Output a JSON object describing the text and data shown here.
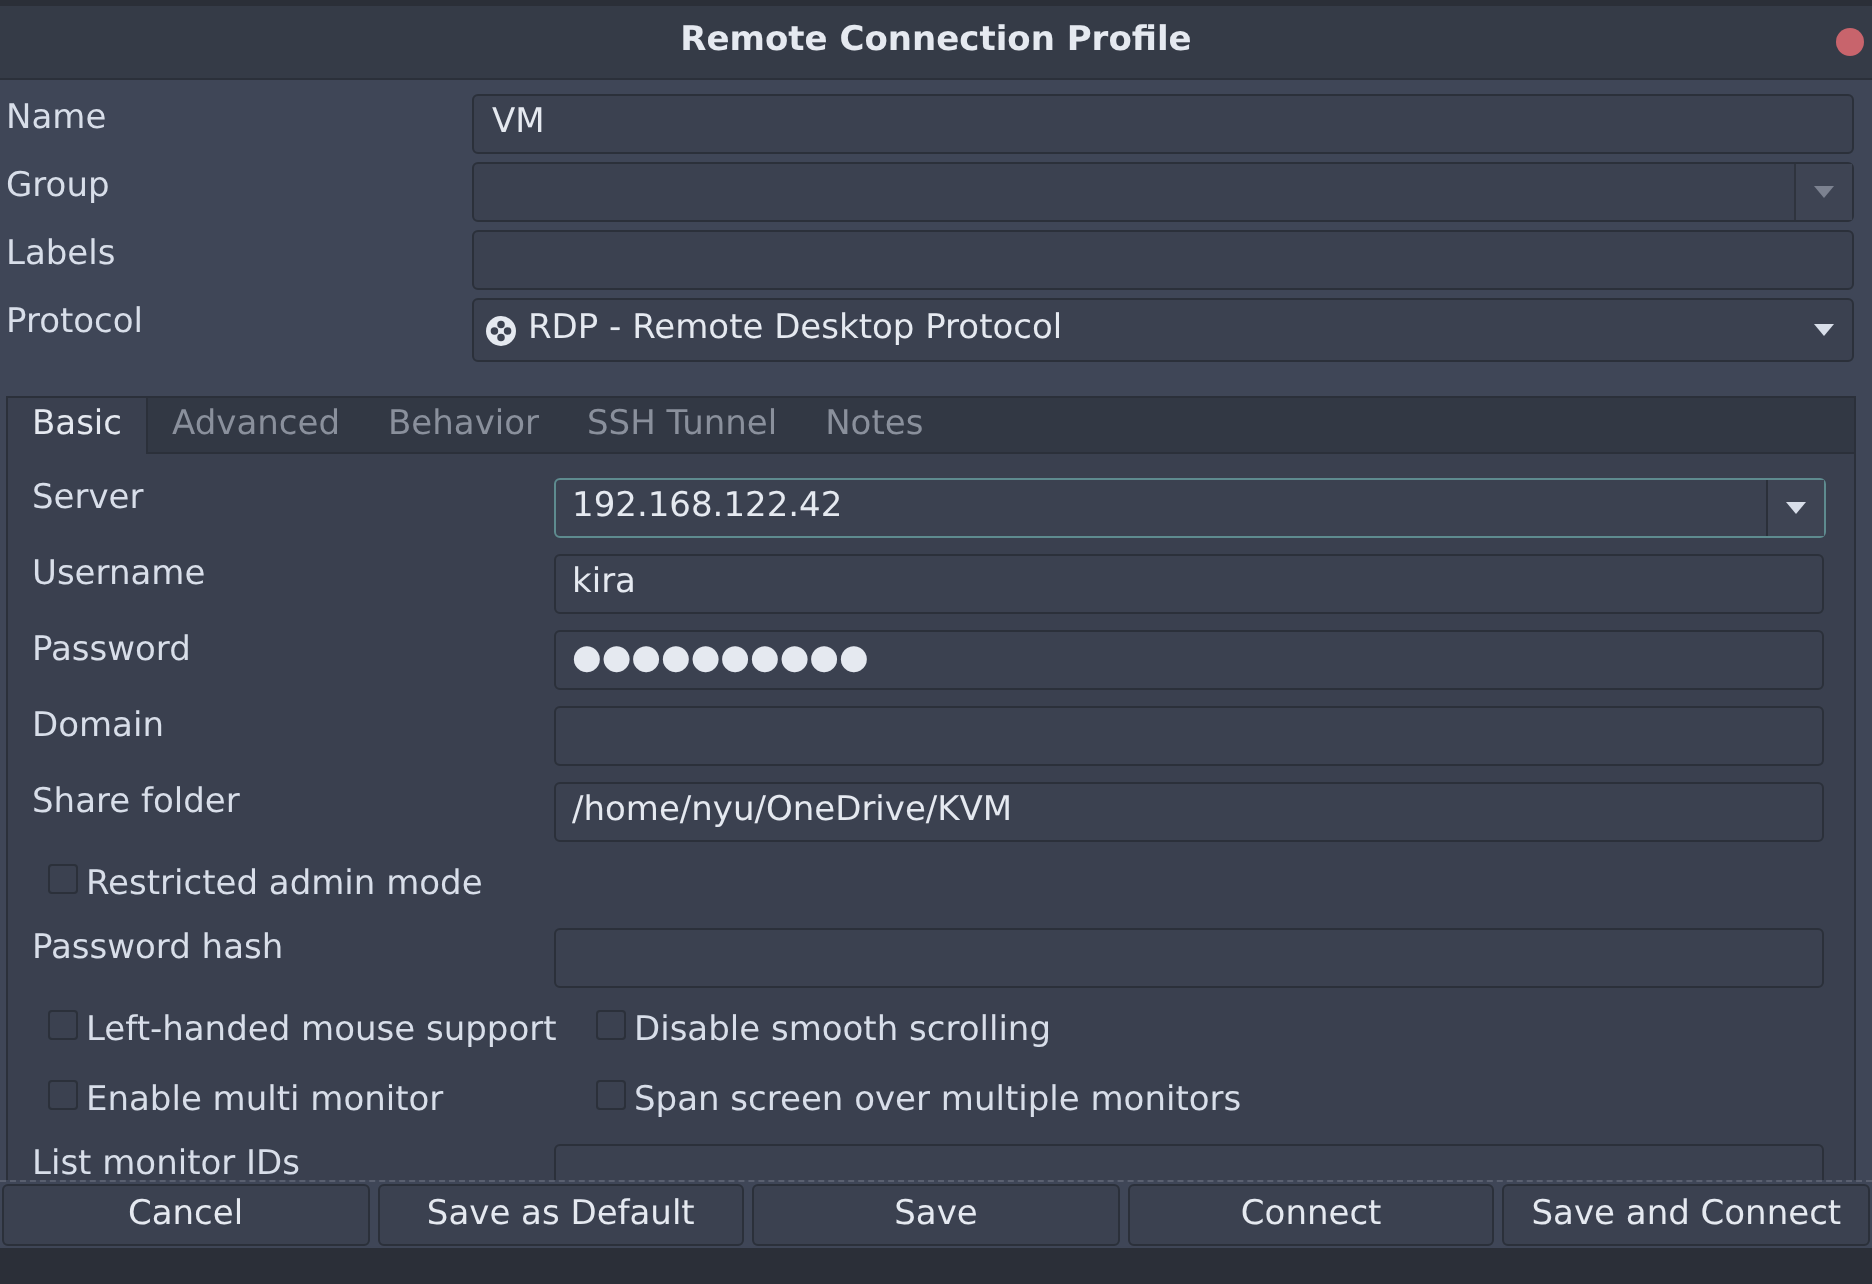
{
  "window": {
    "title": "Remote Connection Profile"
  },
  "fields": [
    {
      "label": "Name",
      "kind": "text",
      "value": "VM"
    },
    {
      "label": "Group",
      "kind": "combo"
    },
    {
      "label": "Labels",
      "kind": "text"
    },
    {
      "label": "Protocol",
      "kind": "select",
      "value": "RDP - Remote Desktop Protocol"
    }
  ],
  "tabs": [
    {
      "label": "Basic",
      "selected": true
    },
    {
      "label": "Advanced",
      "selected": false
    },
    {
      "label": "Behavior",
      "selected": false
    },
    {
      "label": "SSH Tunnel",
      "selected": false
    },
    {
      "label": "Notes",
      "selected": false
    }
  ],
  "basic": [
    {
      "kind": "combo",
      "label": "Server",
      "value": "192.168.122.42",
      "focused": true
    },
    {
      "kind": "text",
      "label": "Username",
      "value": "kira",
      "focused": false
    },
    {
      "kind": "text",
      "label": "Password",
      "value": "●●●●●●●●●●",
      "focused": false
    },
    {
      "kind": "text",
      "label": "Domain",
      "focused": false
    },
    {
      "kind": "text",
      "label": "Share folder",
      "value": "/home/nyu/OneDrive/KVM",
      "focused": false
    },
    {
      "kind": "checks",
      "items": [
        {
          "label": "Restricted admin mode",
          "checked": false
        }
      ]
    },
    {
      "kind": "text",
      "label": "Password hash",
      "focused": false
    },
    {
      "kind": "checks",
      "items": [
        {
          "label": "Left-handed mouse support",
          "checked": false
        },
        {
          "label": "Disable smooth scrolling",
          "checked": false
        }
      ]
    },
    {
      "kind": "checks",
      "items": [
        {
          "label": "Enable multi monitor",
          "checked": false
        },
        {
          "label": "Span screen over multiple monitors",
          "checked": false
        }
      ]
    },
    {
      "kind": "text",
      "label": "List monitor IDs",
      "focused": false
    }
  ],
  "buttons": [
    "Cancel",
    "Save as Default",
    "Save",
    "Connect",
    "Save and Connect"
  ]
}
